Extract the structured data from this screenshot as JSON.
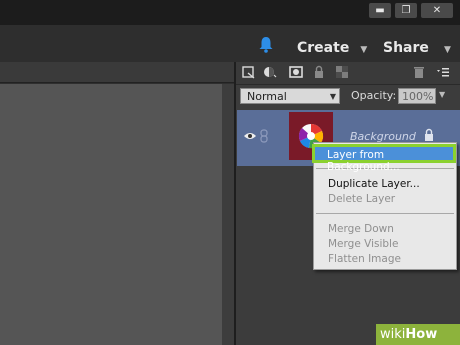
{
  "header": {
    "create_label": "Create",
    "share_label": "Share"
  },
  "window_controls": {
    "minimize": "▬",
    "restore": "❐",
    "close": "✕"
  },
  "layers_panel": {
    "blend_mode": "Normal",
    "opacity_label": "Opacity:",
    "opacity_value": "100%",
    "layer_name": "Background"
  },
  "context_menu": {
    "items": [
      {
        "label": "Layer from Background...",
        "enabled": true,
        "highlighted": true
      },
      {
        "label": "Duplicate Layer...",
        "enabled": true
      },
      {
        "label": "Delete Layer",
        "enabled": false
      },
      {
        "label": "Merge Down",
        "enabled": false
      },
      {
        "label": "Merge Visible",
        "enabled": false
      },
      {
        "label": "Flatten Image",
        "enabled": false
      }
    ]
  },
  "watermark": {
    "prefix": "wiki",
    "suffix": "How"
  },
  "colors": {
    "highlight": "#4b90d9",
    "highlight_border": "#8bd12f",
    "selected_row": "#5a6e98",
    "accent_blue": "#2d8ee8"
  }
}
